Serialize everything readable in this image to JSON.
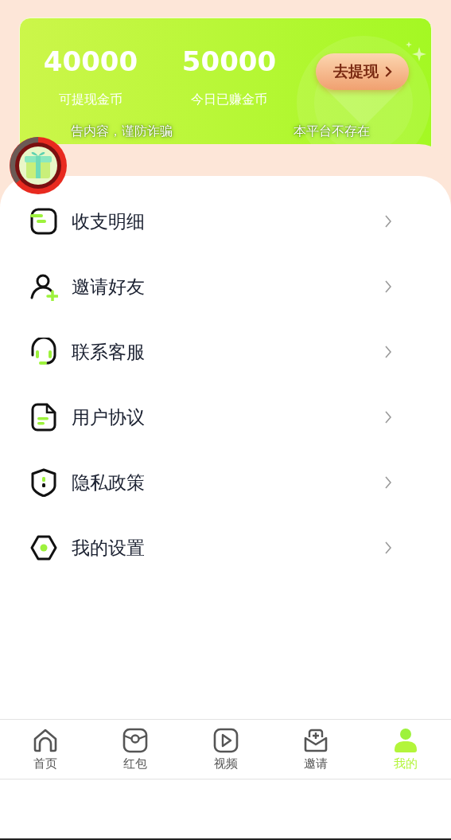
{
  "balance_card": {
    "stats": [
      {
        "value": "40000",
        "label": "可提现金币"
      },
      {
        "value": "50000",
        "label": "今日已赚金币"
      }
    ],
    "withdraw_button": "去提现",
    "notices": [
      "告内容，谨防诈骗",
      "本平台不存在"
    ]
  },
  "menu": [
    {
      "label": "收支明细"
    },
    {
      "label": "邀请好友"
    },
    {
      "label": "联系客服"
    },
    {
      "label": "用户协议"
    },
    {
      "label": "隐私政策"
    },
    {
      "label": "我的设置"
    }
  ],
  "tab_bar": [
    {
      "label": "首页",
      "selected": false
    },
    {
      "label": "红包",
      "selected": false
    },
    {
      "label": "视频",
      "selected": false
    },
    {
      "label": "邀请",
      "selected": false
    },
    {
      "label": "我的",
      "selected": true
    }
  ]
}
